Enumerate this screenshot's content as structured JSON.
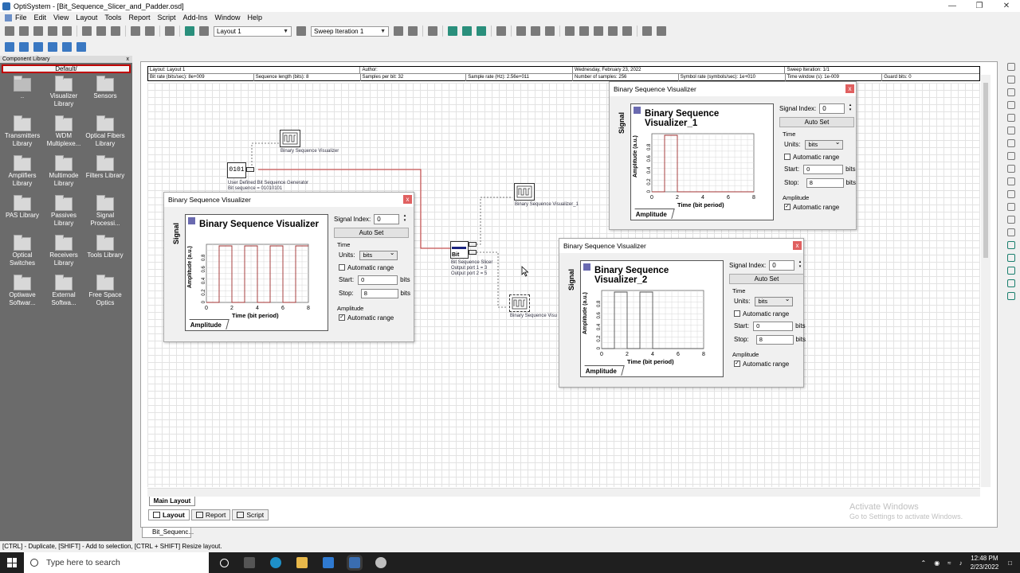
{
  "window": {
    "title": "OptiSystem - [Bit_Sequence_Slicer_and_Padder.osd]",
    "controls": [
      "—",
      "❐",
      "✕"
    ]
  },
  "menu": [
    "File",
    "Edit",
    "View",
    "Layout",
    "Tools",
    "Report",
    "Script",
    "Add-Ins",
    "Window",
    "Help"
  ],
  "toolbar": {
    "layout_combo": "Layout 1",
    "sweep_combo": "Sweep Iteration 1"
  },
  "component_library": {
    "title": "Component Library",
    "close": "x",
    "selected": "Default/",
    "items": [
      "..",
      "Visualizer Library",
      "Sensors",
      "Transmitters Library",
      "WDM Multiplexe...",
      "Optical Fibers Library",
      "Amplifiers Library",
      "Multimode Library",
      "Filters Library",
      "PAS Library",
      "Passives Library",
      "Signal Processi...",
      "Optical Switches",
      "Receivers Library",
      "Tools Library",
      "Optiwave Softwar...",
      "External Softwa...",
      "Free Space Optics"
    ]
  },
  "infobar": {
    "row1": [
      "Layout: Layout 1",
      "Author:",
      "Wednesday, February 23, 2022",
      "Sweep Iteration: 1/1"
    ],
    "row2": [
      "Bit rate (bits/sec): 8e+009",
      "Sequence length (bits): 8",
      "Samples per bit: 32",
      "Sample rate (Hz): 2.56e+011",
      "Number of samples: 256",
      "Symbol rate (symbols/sec): 1e+010",
      "Time window (s): 1e-009",
      "Guard bits: 0"
    ]
  },
  "canvas": {
    "generator_label": "User Defined Bit Sequence Generator",
    "generator_sub": "Bit sequence = 01010101",
    "generator_text": "0101",
    "vis_label": "Binary Sequence Visualizer",
    "vis1_label": "Binary Sequence Visualizer_1",
    "vis2_label": "Binary Sequence Visu",
    "slicer_label": "Bit Sequence Slicer",
    "slicer_text": "Bit",
    "slicer_out1": "Output port 1 = 3",
    "slicer_out2": "Output port 2 = 5",
    "main_tab": "Main Layout"
  },
  "visualizers": [
    {
      "window_title": "Binary Sequence Visualizer",
      "plot_title": "Binary Sequence Visualizer",
      "bits": [
        0,
        1,
        0,
        1,
        0,
        1,
        0,
        1
      ]
    },
    {
      "window_title": "Binary Sequence Visualizer",
      "plot_title": "Binary Sequence Visualizer_1",
      "bits": [
        0,
        1,
        0,
        0,
        0,
        0,
        0,
        0
      ]
    },
    {
      "window_title": "Binary Sequence Visualizer",
      "plot_title": "Binary Sequence Visualizer_2",
      "bits": [
        0,
        1,
        0,
        1,
        0,
        0,
        0,
        0
      ]
    }
  ],
  "vis_common": {
    "signal_tab": "Signal",
    "amplitude_tab": "Amplitude",
    "y_label": "Amplitude (a.u.)",
    "x_label": "Time (bit period)",
    "y_ticks": [
      "0",
      "0.2",
      "0.4",
      "0.6",
      "0.8"
    ],
    "x_ticks": [
      "0",
      "2",
      "4",
      "6",
      "8"
    ],
    "signal_index_label": "Signal Index:",
    "signal_index": "0",
    "auto_set": "Auto Set",
    "time_group": "Time",
    "units_label": "Units:",
    "units_value": "bits",
    "auto_range": "Automatic range",
    "start_label": "Start:",
    "start_value": "0",
    "stop_label": "Stop:",
    "stop_value": "8",
    "bits_unit": "bits",
    "amplitude_group": "Amplitude",
    "close": "x"
  },
  "bottom_tabs": [
    "Layout",
    "Report",
    "Script"
  ],
  "doc_tab": "Bit_Sequenc...",
  "status": "[CTRL] - Duplicate, [SHIFT] - Add to selection, [CTRL + SHIFT] Resize layout.",
  "watermark": {
    "line1": "Activate Windows",
    "line2": "Go to Settings to activate Windows."
  },
  "taskbar": {
    "search_placeholder": "Type here to search",
    "time": "12:48 PM",
    "date": "2/23/2022"
  }
}
